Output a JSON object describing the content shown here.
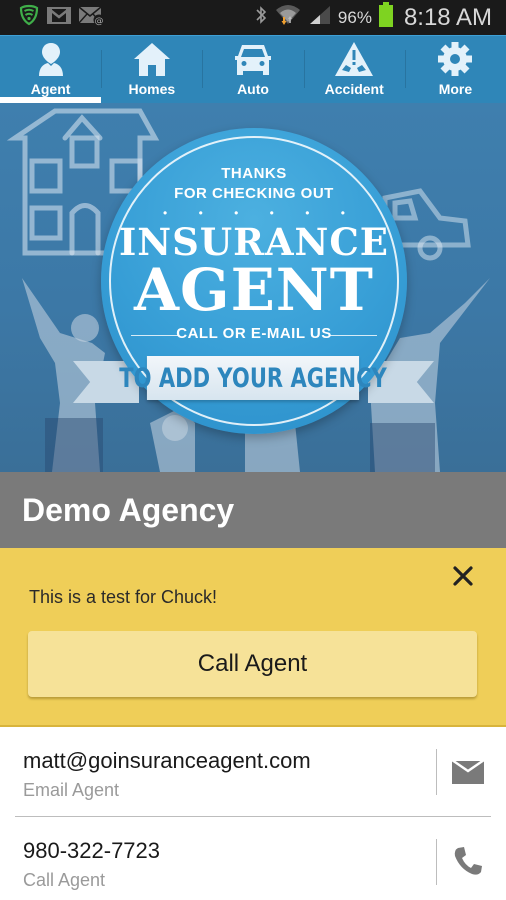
{
  "status_bar": {
    "left_icons": [
      "shield-security-icon",
      "gmail-icon",
      "email-at-icon"
    ],
    "right_icons": [
      "bluetooth-icon",
      "wifi-icon",
      "signal-icon",
      "battery-icon"
    ],
    "battery_percent": "96%",
    "time": "8:18 AM",
    "colors": {
      "shield": "#3fae49",
      "battery": "#7ed321"
    }
  },
  "nav": {
    "tabs": [
      {
        "label": "Agent",
        "icon": "person-icon",
        "active": true
      },
      {
        "label": "Homes",
        "icon": "house-icon",
        "active": false
      },
      {
        "label": "Auto",
        "icon": "car-icon",
        "active": false
      },
      {
        "label": "Accident",
        "icon": "accident-warning-icon",
        "active": false
      },
      {
        "label": "More",
        "icon": "gear-icon",
        "active": false
      }
    ],
    "colors": {
      "background": "#2f86b8",
      "active_indicator": "#ffffff"
    }
  },
  "banner": {
    "line1": "THANKS",
    "line2": "FOR CHECKING OUT",
    "dots": "• • • • • •",
    "title1": "INSURANCE",
    "title2": "AGENT",
    "line3": "CALL OR E-MAIL US",
    "ribbon": "TO ADD YOUR AGENCY"
  },
  "agency": {
    "name": "Demo Agency"
  },
  "notice": {
    "message": "This is a test for Chuck!",
    "button_label": "Call Agent",
    "close_icon": "close-icon",
    "colors": {
      "background": "#efce58",
      "button": "#f6e298"
    }
  },
  "contacts": [
    {
      "primary": "matt@goinsuranceagent.com",
      "secondary": "Email Agent",
      "icon": "envelope-icon"
    },
    {
      "primary": "980-322-7723",
      "secondary": "Call Agent",
      "icon": "phone-icon"
    }
  ]
}
